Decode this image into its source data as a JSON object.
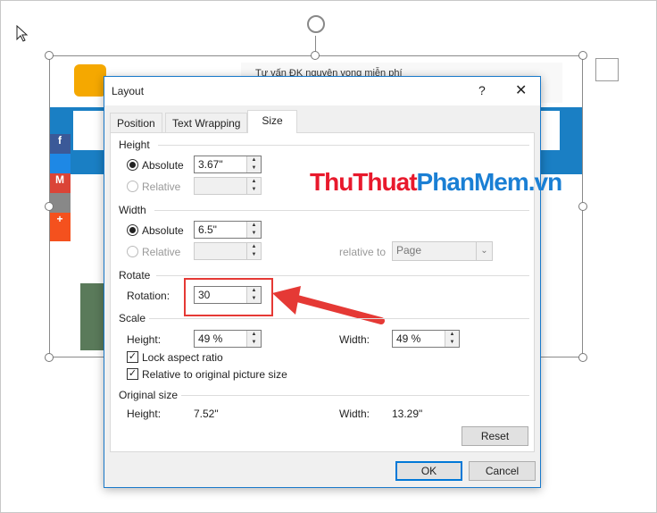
{
  "picture": {
    "ad_text": "Tư vấn ĐK nguyện vọng miễn phí",
    "watermark": "ThuThuatPhanMem.vn",
    "watermark_colors": {
      "red": "#e8192c",
      "blue": "#1a7fd4"
    },
    "social": [
      "facebook",
      "messenger",
      "gmail",
      "email",
      "plus"
    ]
  },
  "dialog": {
    "title": "Layout",
    "help": "?",
    "close": "✕",
    "tabs": [
      {
        "label": "Position"
      },
      {
        "label": "Text Wrapping"
      },
      {
        "label": "Size",
        "active": true
      }
    ],
    "height": {
      "label": "Height",
      "absolute_label": "Absolute",
      "absolute_value": "3.67\"",
      "relative_label": "Relative",
      "relative_value": ""
    },
    "width": {
      "label": "Width",
      "absolute_label": "Absolute",
      "absolute_value": "6.5\"",
      "relative_label": "Relative",
      "relative_value": "",
      "relative_to_label": "relative to",
      "relative_to_value": "Page"
    },
    "rotate": {
      "label": "Rotate",
      "rotation_label": "Rotation:",
      "rotation_value": "30"
    },
    "scale": {
      "label": "Scale",
      "height_label": "Height:",
      "height_value": "49 %",
      "width_label": "Width:",
      "width_value": "49 %",
      "lock_label": "Lock aspect ratio",
      "lock_checked": true,
      "relative_label": "Relative to original picture size",
      "relative_checked": true
    },
    "original": {
      "label": "Original size",
      "height_label": "Height:",
      "height_value": "7.52\"",
      "width_label": "Width:",
      "width_value": "13.29\""
    },
    "reset": "Reset",
    "ok": "OK",
    "cancel": "Cancel"
  },
  "highlight_color": "#e53935"
}
